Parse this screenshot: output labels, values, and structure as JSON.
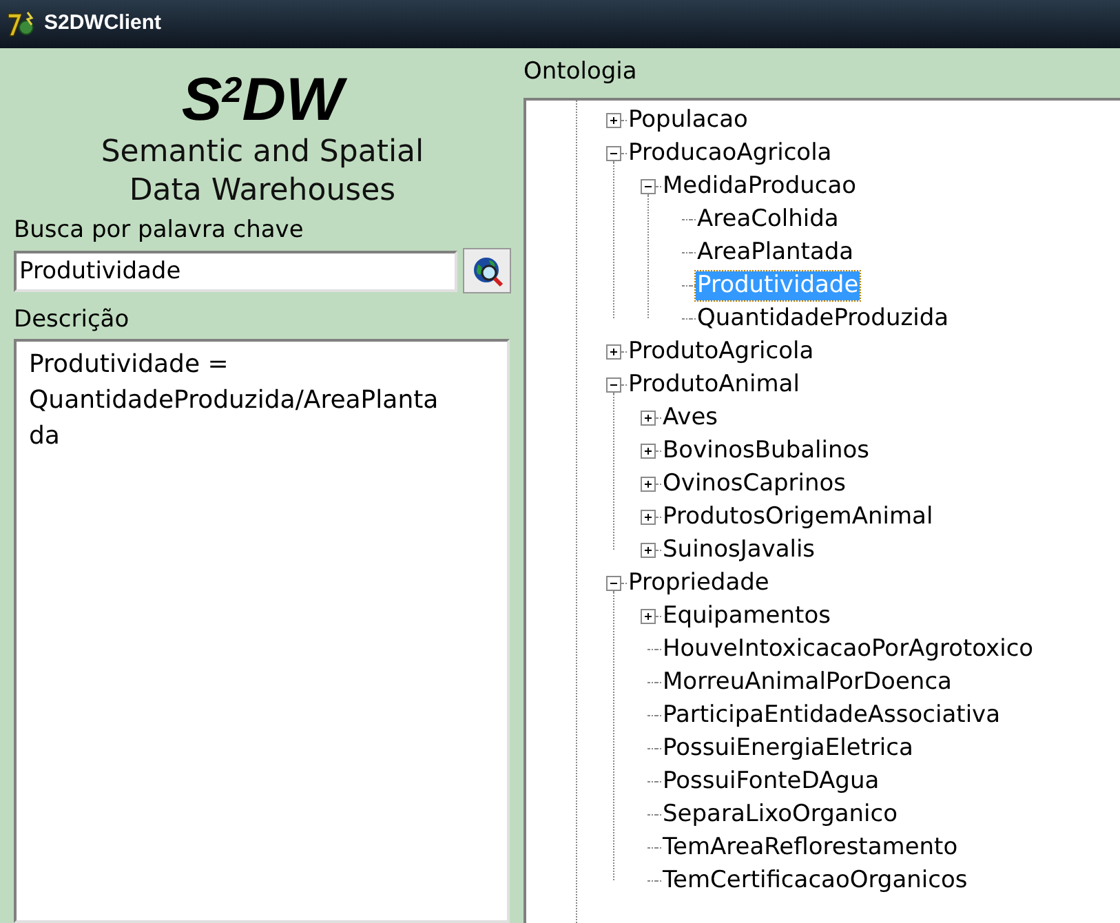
{
  "window": {
    "title": "S2DWClient"
  },
  "logo": "S$^{2}$DW",
  "subtitle": [
    "Semantic and Spatial",
    "Data Warehouses"
  ],
  "search": {
    "label": "Busca por palavra chave",
    "value": "Produtividade"
  },
  "description": {
    "label": "Descrição",
    "text": "Produtividade = QuantidadeProduzida/AreaPlantada"
  },
  "ontology": {
    "label": "Ontologia",
    "tree": [
      {
        "label": "Populacao",
        "kind": "branch",
        "expanded": false,
        "selected": false
      },
      {
        "label": "ProducaoAgricola",
        "kind": "branch",
        "expanded": true,
        "selected": false,
        "children": [
          {
            "label": "MedidaProducao",
            "kind": "branch",
            "expanded": true,
            "selected": false,
            "children": [
              {
                "label": "AreaColhida",
                "kind": "leaf",
                "selected": false
              },
              {
                "label": "AreaPlantada",
                "kind": "leaf",
                "selected": false
              },
              {
                "label": "Produtividade",
                "kind": "leaf",
                "selected": true
              },
              {
                "label": "QuantidadeProduzida",
                "kind": "leaf",
                "selected": false
              }
            ]
          }
        ]
      },
      {
        "label": "ProdutoAgricola",
        "kind": "branch",
        "expanded": false,
        "selected": false
      },
      {
        "label": "ProdutoAnimal",
        "kind": "branch",
        "expanded": true,
        "selected": false,
        "children": [
          {
            "label": "Aves",
            "kind": "branch",
            "expanded": false,
            "selected": false
          },
          {
            "label": "BovinosBubalinos",
            "kind": "branch",
            "expanded": false,
            "selected": false
          },
          {
            "label": "OvinosCaprinos",
            "kind": "branch",
            "expanded": false,
            "selected": false
          },
          {
            "label": "ProdutosOrigemAnimal",
            "kind": "branch",
            "expanded": false,
            "selected": false
          },
          {
            "label": "SuinosJavalis",
            "kind": "branch",
            "expanded": false,
            "selected": false
          }
        ]
      },
      {
        "label": "Propriedade",
        "kind": "branch",
        "expanded": true,
        "selected": false,
        "children": [
          {
            "label": "Equipamentos",
            "kind": "branch",
            "expanded": false,
            "selected": false
          },
          {
            "label": "HouveIntoxicacaoPorAgrotoxico",
            "kind": "leaf",
            "selected": false
          },
          {
            "label": "MorreuAnimalPorDoenca",
            "kind": "leaf",
            "selected": false
          },
          {
            "label": "ParticipaEntidadeAssociativa",
            "kind": "leaf",
            "selected": false
          },
          {
            "label": "PossuiEnergiaEletrica",
            "kind": "leaf",
            "selected": false
          },
          {
            "label": "PossuiFonteDAgua",
            "kind": "leaf",
            "selected": false
          },
          {
            "label": "SeparaLixoOrganico",
            "kind": "leaf",
            "selected": false
          },
          {
            "label": "TemAreaReflorestamento",
            "kind": "leaf",
            "selected": false
          },
          {
            "label": "TemCertificacaoOrganicos",
            "kind": "leaf",
            "selected": false
          }
        ]
      }
    ]
  }
}
